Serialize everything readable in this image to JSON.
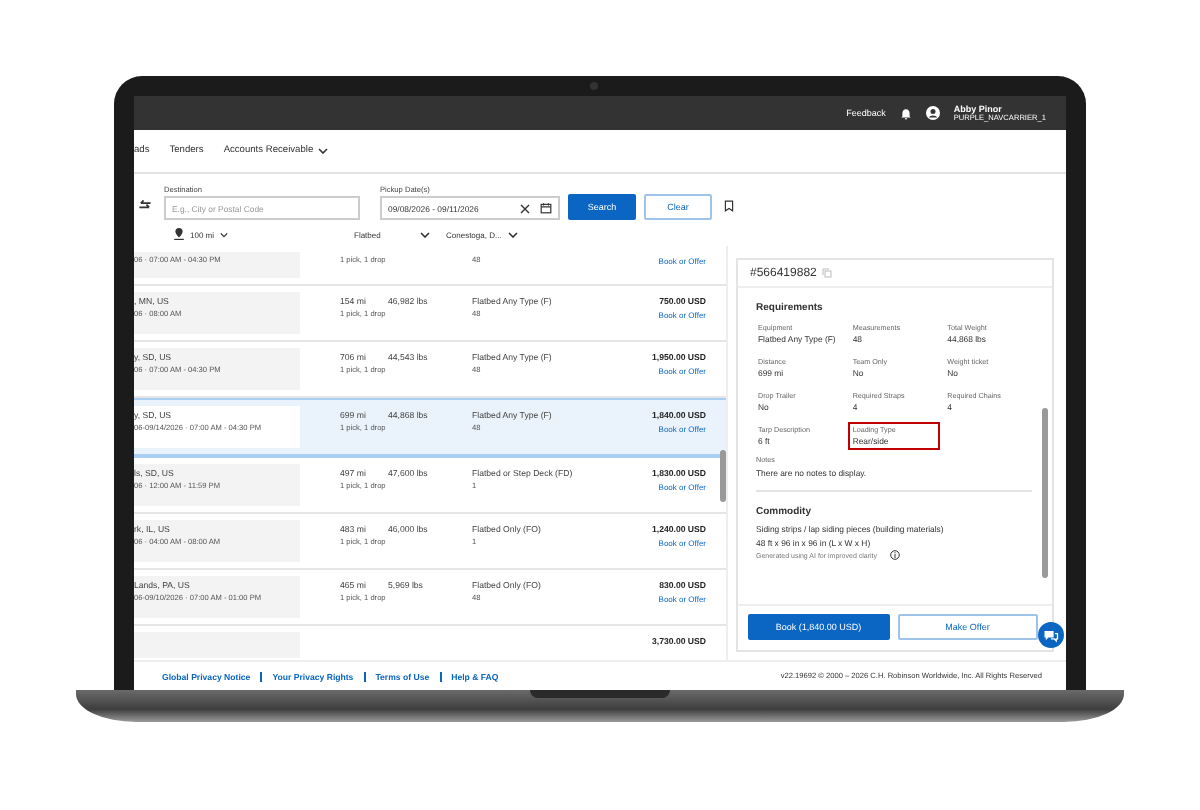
{
  "top_bar": {
    "feedback": "Feedback",
    "user_name": "Abby Pinor",
    "user_account": "PURPLE_NAVCARRIER_1"
  },
  "nav": {
    "items": [
      {
        "label": "ads",
        "dropdown": false
      },
      {
        "label": "Tenders",
        "dropdown": false
      },
      {
        "label": "Accounts Receivable",
        "dropdown": true
      }
    ]
  },
  "search": {
    "destination": {
      "label": "Destination",
      "placeholder": "E.g., City or Postal Code"
    },
    "pickup": {
      "label": "Pickup Date(s)",
      "value": "09/08/2026 - 09/11/2026"
    },
    "search_button": "Search",
    "clear_button": "Clear",
    "radius": "100 mi",
    "equipment": "Flatbed",
    "trailer": "Conestoga, D..."
  },
  "loads": [
    {
      "date": "06 · 07:00 AM - 04:30 PM",
      "stops": "1 pick, 1 drop",
      "length": "48",
      "action": "Book or Offer",
      "selected": false
    },
    {
      "origin": ", MN, US",
      "date": "06 · 08:00 AM",
      "miles": "154 mi",
      "stops": "1 pick, 1 drop",
      "weight": "46,982 lbs",
      "equipment": "Flatbed Any Type (F)",
      "length": "48",
      "price": "750.00 USD",
      "action": "Book or Offer",
      "selected": false
    },
    {
      "origin": "y, SD, US",
      "date": "06 · 07:00 AM - 04:30 PM",
      "miles": "706 mi",
      "stops": "1 pick, 1 drop",
      "weight": "44,543 lbs",
      "equipment": "Flatbed Any Type (F)",
      "length": "48",
      "price": "1,950.00 USD",
      "action": "Book or Offer",
      "selected": false
    },
    {
      "origin": "y, SD, US",
      "date": "06-09/14/2026 · 07:00 AM - 04:30 PM",
      "miles": "699 mi",
      "stops": "1 pick, 1 drop",
      "weight": "44,868 lbs",
      "equipment": "Flatbed Any Type (F)",
      "length": "48",
      "price": "1,840.00 USD",
      "action": "Book or Offer",
      "selected": true
    },
    {
      "origin": "ls, SD, US",
      "date": "06 · 12:00 AM - 11:59 PM",
      "miles": "497 mi",
      "stops": "1 pick, 1 drop",
      "weight": "47,600 lbs",
      "equipment": "Flatbed or Step Deck (FD)",
      "length": "1",
      "price": "1,830.00 USD",
      "action": "Book or Offer",
      "selected": false
    },
    {
      "origin": "rk, IL, US",
      "date": "06 · 04:00 AM - 08:00 AM",
      "miles": "483 mi",
      "stops": "1 pick, 1 drop",
      "weight": "46,000 lbs",
      "equipment": "Flatbed Only (FO)",
      "length": "1",
      "price": "1,240.00 USD",
      "action": "Book or Offer",
      "selected": false
    },
    {
      "origin": "Lands, PA, US",
      "date": "06-09/10/2026 · 07:00 AM - 01:00 PM",
      "miles": "465 mi",
      "stops": "1 pick, 1 drop",
      "weight": "5,969 lbs",
      "equipment": "Flatbed Only (FO)",
      "length": "48",
      "price": "830.00 USD",
      "action": "Book or Offer",
      "selected": false
    },
    {
      "price": "3,730.00 USD",
      "selected": false
    }
  ],
  "detail": {
    "load_number": "#566419882",
    "requirements_title": "Requirements",
    "requirements": [
      {
        "label": "Equipment",
        "value": "Flatbed Any Type (F)",
        "highlighted": false
      },
      {
        "label": "Measurements",
        "value": "48",
        "highlighted": false
      },
      {
        "label": "Total Weight",
        "value": "44,868 lbs",
        "highlighted": false
      },
      {
        "label": "Distance",
        "value": "699 mi",
        "highlighted": false
      },
      {
        "label": "Team Only",
        "value": "No",
        "highlighted": false
      },
      {
        "label": "Weight ticket",
        "value": "No",
        "highlighted": false
      },
      {
        "label": "Drop Trailer",
        "value": "No",
        "highlighted": false
      },
      {
        "label": "Required Straps",
        "value": "4",
        "highlighted": false
      },
      {
        "label": "Required Chains",
        "value": "4",
        "highlighted": false
      },
      {
        "label": "Tarp Description",
        "value": "6 ft",
        "highlighted": false
      },
      {
        "label": "Loading Type",
        "value": "Rear/side",
        "highlighted": true
      }
    ],
    "notes_label": "Notes",
    "notes": "There are no notes to display.",
    "commodity_title": "Commodity",
    "commodity": "Siding strips / lap siding pieces (building materials)",
    "dimensions": "48 ft x 96 in x 96 in (L x W x H)",
    "ai_note": "Generated using AI for improved clarity",
    "book_button": "Book (1,840.00 USD)",
    "offer_button": "Make Offer"
  },
  "footer": {
    "links": [
      "Global Privacy Notice",
      "Your Privacy Rights",
      "Terms of Use",
      "Help & FAQ"
    ],
    "copyright": "v22.19692 © 2000 – 2026 C.H. Robinson Worldwide, Inc. All Rights Reserved"
  }
}
